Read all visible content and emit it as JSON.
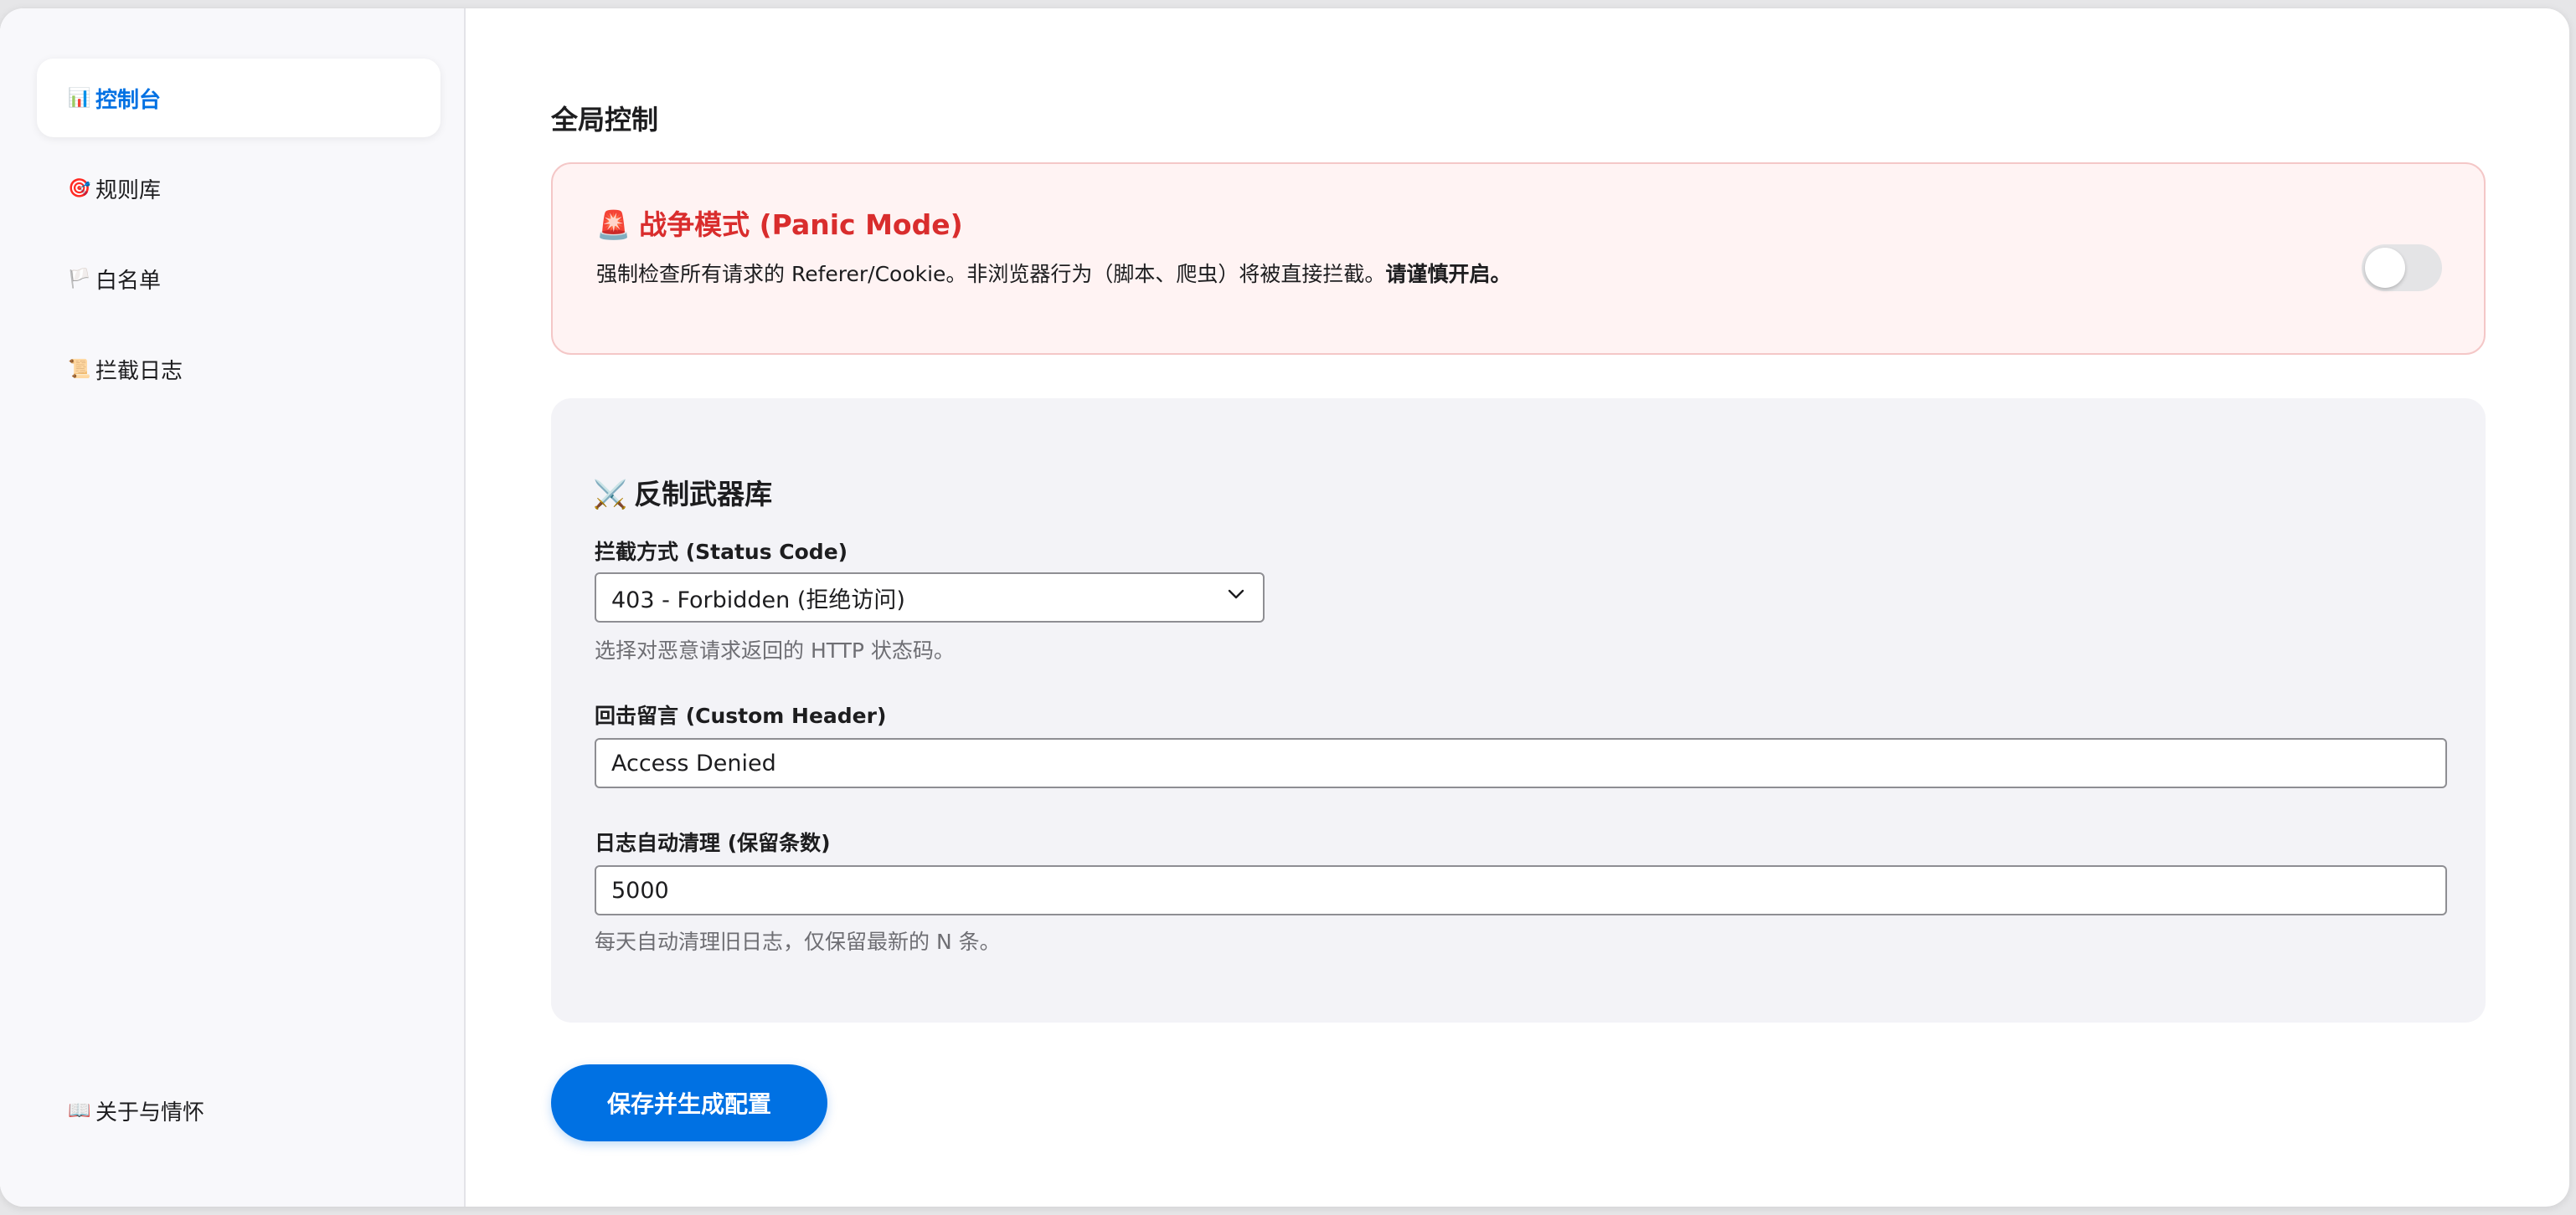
{
  "sidebar": {
    "items": [
      {
        "icon": "📊",
        "label": "控制台",
        "active": true
      },
      {
        "icon": "🎯",
        "label": "规则库"
      },
      {
        "icon": "🏳️",
        "label": "白名单"
      },
      {
        "icon": "📜",
        "label": "拦截日志"
      }
    ],
    "bottom_item": {
      "icon": "📖",
      "label": "关于与情怀"
    }
  },
  "main": {
    "section_title": "全局控制",
    "panic": {
      "icon": "🚨",
      "title": "战争模式 (Panic Mode)",
      "description": "强制检查所有请求的 Referer/Cookie。非浏览器行为（脚本、爬虫）将被直接拦截。",
      "warning": "请谨慎开启。",
      "enabled": false
    },
    "arsenal": {
      "icon": "⚔️",
      "title": "反制武器库",
      "status_code": {
        "label": "拦截方式 (Status Code)",
        "value": "403 - Forbidden (拒绝访问)",
        "help": "选择对恶意请求返回的 HTTP 状态码。"
      },
      "custom_header": {
        "label": "回击留言 (Custom Header)",
        "value": "Access Denied"
      },
      "log_cleanup": {
        "label": "日志自动清理 (保留条数)",
        "value": "5000",
        "help": "每天自动清理旧日志，仅保留最新的 N 条。"
      }
    },
    "save_label": "保存并生成配置"
  },
  "colors": {
    "accent": "#0071e3",
    "danger": "#d92d2d",
    "danger_bg": "#fff3f3"
  }
}
